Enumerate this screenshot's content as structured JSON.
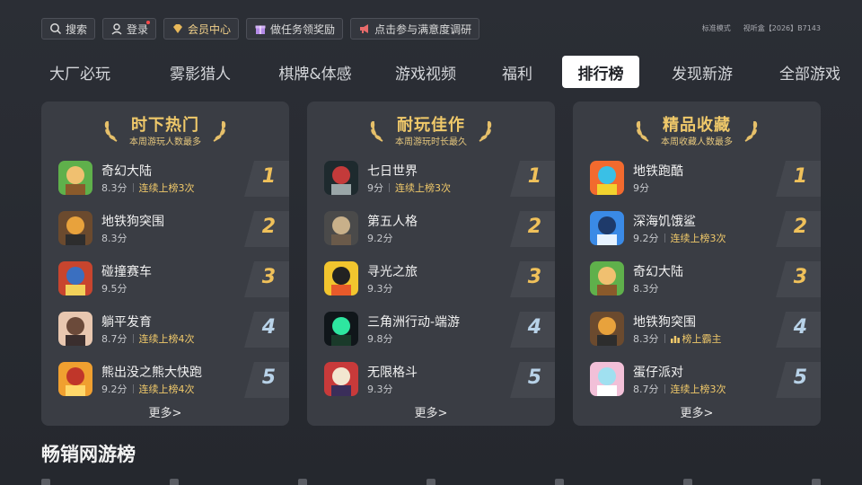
{
  "topbar": {
    "search": "搜索",
    "login": "登录",
    "vip": "会员中心",
    "tasks": "做任务领奖励",
    "survey": "点击参与满意度调研",
    "mode": "标准模式",
    "device": "视听盒【2026】B7143"
  },
  "tabs": [
    "大厂必玩",
    "雾影猎人",
    "棋牌&体感",
    "游戏视频",
    "福利",
    "排行榜",
    "发现新游",
    "全部游戏"
  ],
  "active_tab": "排行榜",
  "cards": [
    {
      "title": "时下热门",
      "subtitle": "本周游玩人数最多",
      "more": "更多>",
      "items": [
        {
          "name": "奇幻大陆",
          "score": "8.3分",
          "tag": "连续上榜3次",
          "rank": "1"
        },
        {
          "name": "地铁狗突围",
          "score": "8.3分",
          "tag": "",
          "rank": "2"
        },
        {
          "name": "碰撞赛车",
          "score": "9.5分",
          "tag": "",
          "rank": "3"
        },
        {
          "name": "躺平发育",
          "score": "8.7分",
          "tag": "连续上榜4次",
          "rank": "4"
        },
        {
          "name": "熊出没之熊大快跑",
          "score": "9.2分",
          "tag": "连续上榜4次",
          "rank": "5"
        }
      ]
    },
    {
      "title": "耐玩佳作",
      "subtitle": "本周游玩时长最久",
      "more": "更多>",
      "items": [
        {
          "name": "七日世界",
          "score": "9分",
          "tag": "连续上榜3次",
          "rank": "1"
        },
        {
          "name": "第五人格",
          "score": "9.2分",
          "tag": "",
          "rank": "2"
        },
        {
          "name": "寻光之旅",
          "score": "9.3分",
          "tag": "",
          "rank": "3"
        },
        {
          "name": "三角洲行动-端游",
          "score": "9.8分",
          "tag": "",
          "rank": "4"
        },
        {
          "name": "无限格斗",
          "score": "9.3分",
          "tag": "",
          "rank": "5"
        }
      ]
    },
    {
      "title": "精品收藏",
      "subtitle": "本周收藏人数最多",
      "more": "更多>",
      "items": [
        {
          "name": "地铁跑酷",
          "score": "9分",
          "tag": "",
          "rank": "1"
        },
        {
          "name": "深海饥饿鲨",
          "score": "9.2分",
          "tag": "连续上榜3次",
          "rank": "2"
        },
        {
          "name": "奇幻大陆",
          "score": "8.3分",
          "tag": "",
          "rank": "3"
        },
        {
          "name": "地铁狗突围",
          "score": "8.3分",
          "tag": "榜上霸主",
          "rank": "4"
        },
        {
          "name": "蛋仔派对",
          "score": "8.7分",
          "tag": "连续上榜3次",
          "rank": "5"
        }
      ]
    }
  ],
  "section_title": "畅销网游榜"
}
